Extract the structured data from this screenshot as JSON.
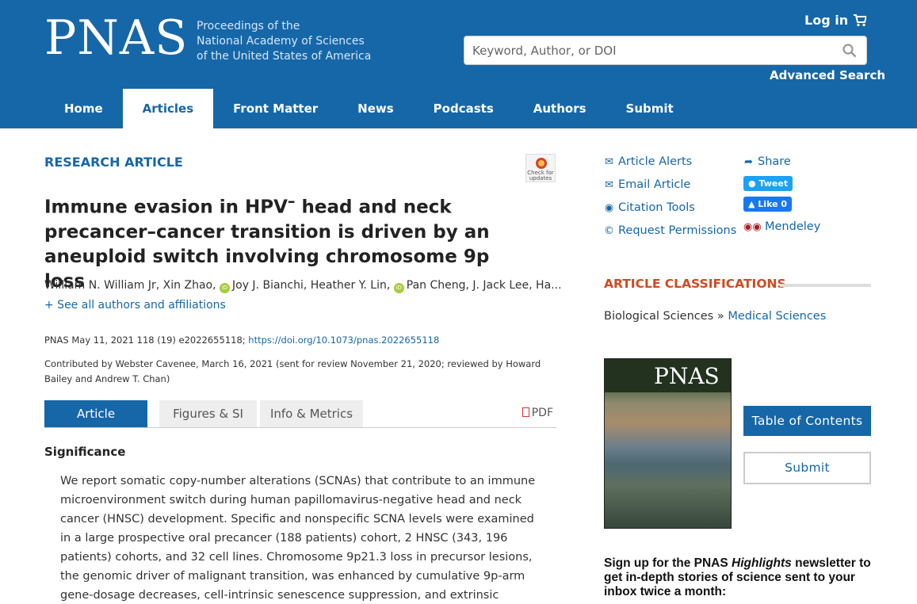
{
  "header": {
    "logo": "PNAS",
    "logo_lines": [
      "Proceedings of the",
      "National Academy of Sciences",
      "of the United States of America"
    ],
    "login": "Log in",
    "search_placeholder": "Keyword, Author, or DOI",
    "advanced_search": "Advanced Search",
    "colors": {
      "brand": "#1667a8"
    }
  },
  "nav": [
    {
      "label": "Home"
    },
    {
      "label": "Articles"
    },
    {
      "label": "Front Matter"
    },
    {
      "label": "News"
    },
    {
      "label": "Podcasts"
    },
    {
      "label": "Authors"
    },
    {
      "label": "Submit"
    }
  ],
  "article": {
    "type": "RESEARCH ARTICLE",
    "check_updates": "Check for updates",
    "title_a": "Immune evasion in HPV",
    "title_sup": "–",
    "title_b": " head and neck precancer–cancer transition is driven by an aneuploid switch involving chromosome 9p loss",
    "authors_1": "William N. William Jr, Xin Zhao,",
    "authors_2": "Joy J. Bianchi, Heather Y. Lin,",
    "authors_3": "Pan Cheng, J. Jack Lee, Ha...",
    "see_all": "+ See all authors and affiliations",
    "citation": "PNAS May 11, 2021 118 (19) e2022655118;",
    "doi": "https://doi.org/10.1073/pnas.2022655118",
    "contributed": "Contributed by Webster Cavenee, March 16, 2021 (sent for review November 21, 2020; reviewed by Howard Bailey and Andrew T. Chan)"
  },
  "tabs": {
    "article": "Article",
    "figures": "Figures & SI",
    "info": "Info & Metrics",
    "pdf": "PDF"
  },
  "significance": {
    "heading": "Significance",
    "text": "We report somatic copy-number alterations (SCNAs) that contribute to an immune microenvironment switch during human papillomavirus-negative head and neck cancer (HNSC) development. Specific and nonspecific SCNA levels were examined in a large prospective oral precancer (188 patients) cohort, 2 HNSC (343, 196 patients) cohorts, and 32 cell lines. Chromosome 9p21.3 loss in precursor lesions, the genomic driver of malignant transition, was enhanced by cumulative 9p-arm gene-dosage decreases, cell-intrinsic senescence suppression, and extrinsic decreases in"
  },
  "sidebar": {
    "tools": {
      "alerts": "Article Alerts",
      "email": "Email Article",
      "citation": "Citation Tools",
      "permissions": "Request Permissions",
      "share": "Share",
      "tweet": "Tweet",
      "like": "Like 0",
      "mendeley": "Mendeley"
    },
    "classifications_heading": "ARTICLE CLASSIFICATIONS",
    "class_primary": "Biological Sciences",
    "class_sep": " » ",
    "class_secondary": "Medical Sciences",
    "cover_logo": "PNAS",
    "toc_button": "Table of Contents",
    "submit_button": "Submit",
    "newsletter_a": "Sign up for the PNAS ",
    "newsletter_em": "Highlights",
    "newsletter_b": " newsletter to get in-depth stories of science sent to your inbox twice a month:"
  }
}
